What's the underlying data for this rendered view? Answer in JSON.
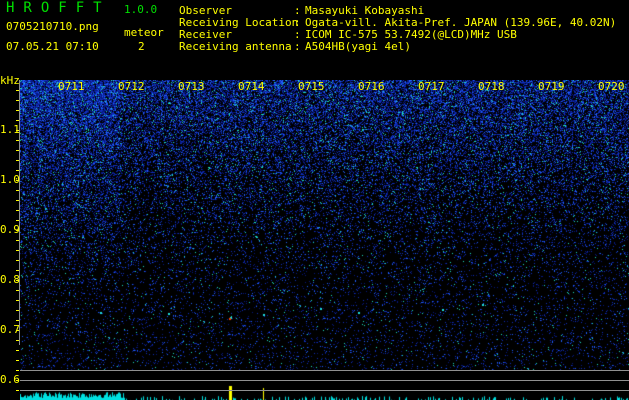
{
  "header": {
    "app_title": "HROFFT",
    "version": "1.0.0",
    "filename": "0705210710.png",
    "datetime": "07.05.21 07:10",
    "meteor_label": "meteor",
    "meteor_count": "2",
    "info": [
      {
        "label": "Observer",
        "value": "Masayuki Kobayashi"
      },
      {
        "label": "Receiving Location",
        "value": "Ogata-vill. Akita-Pref. JAPAN (139.96E, 40.02N)"
      },
      {
        "label": "Receiver",
        "value": "ICOM IC-575 53.7492(@LCD)MHz USB"
      },
      {
        "label": "Receiving antenna",
        "value": "A504HB(yagi 4el)"
      }
    ]
  },
  "spectrogram": {
    "y_unit": "kHz",
    "y_ticks": [
      "1.1",
      "1.0",
      "0.9",
      "0.8",
      "0.7",
      "0.6"
    ],
    "time_labels": [
      "0711",
      "0712",
      "0713",
      "0714",
      "0715",
      "0716",
      "0717",
      "0718",
      "0719",
      "0720"
    ],
    "colors": {
      "background": "#000000",
      "noise": "#1030d0",
      "text": "#ffff00",
      "title": "#00e000",
      "trace": "#00e0e0"
    }
  }
}
